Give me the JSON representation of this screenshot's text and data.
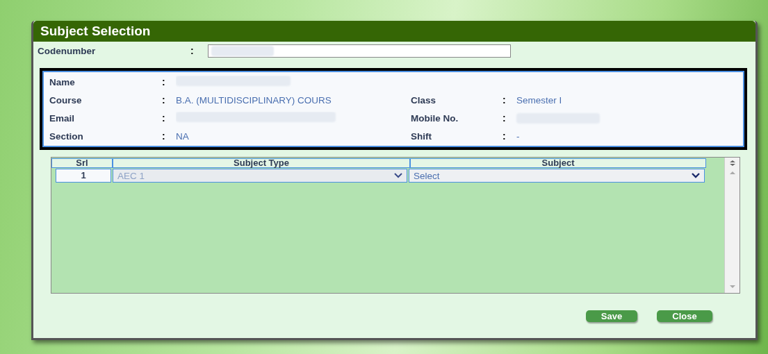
{
  "window": {
    "title": "Subject Selection"
  },
  "codenumber": {
    "label": "Codenumber",
    "separator": ":",
    "redacted": true
  },
  "student": {
    "fields": [
      {
        "label": "Name",
        "separator": ":",
        "redacted": true
      },
      {
        "label": "Course",
        "separator": ":",
        "value": "B.A. (MULTIDISCIPLINARY) COURS",
        "label2": "Class",
        "separator2": ":",
        "value2": "Semester I"
      },
      {
        "label": "Email",
        "separator": ":",
        "redacted": true,
        "label2": "Mobile No.",
        "separator2": ":",
        "redacted2": true
      },
      {
        "label": "Section",
        "separator": ":",
        "value": "NA",
        "label2": "Shift",
        "separator2": ":",
        "value2": "-"
      }
    ]
  },
  "table": {
    "columns": [
      "Srl",
      "Subject Type",
      "Subject"
    ],
    "rows": [
      {
        "srl": "1",
        "subject_type": "AEC 1",
        "subject_type_disabled": true,
        "subject": "Select",
        "subject_disabled": false
      }
    ]
  },
  "buttons": [
    "Save",
    "Close"
  ]
}
